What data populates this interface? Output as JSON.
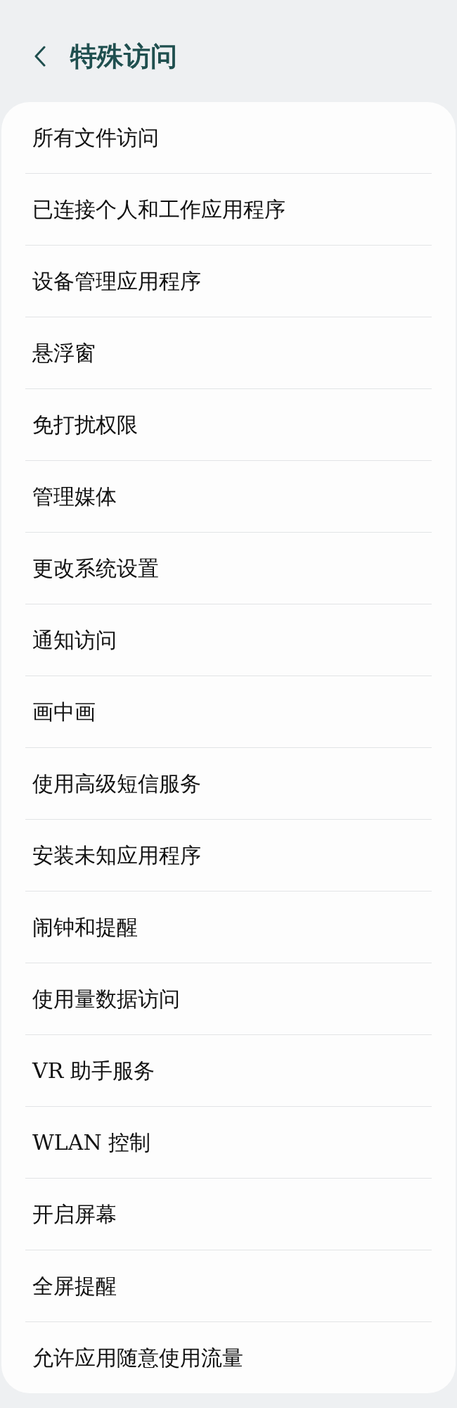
{
  "header": {
    "title": "特殊访问"
  },
  "items": [
    {
      "label": "所有文件访问"
    },
    {
      "label": "已连接个人和工作应用程序"
    },
    {
      "label": "设备管理应用程序"
    },
    {
      "label": "悬浮窗"
    },
    {
      "label": "免打扰权限"
    },
    {
      "label": "管理媒体"
    },
    {
      "label": "更改系统设置"
    },
    {
      "label": "通知访问"
    },
    {
      "label": "画中画"
    },
    {
      "label": "使用高级短信服务"
    },
    {
      "label": "安装未知应用程序"
    },
    {
      "label": "闹钟和提醒"
    },
    {
      "label": "使用量数据访问"
    },
    {
      "label": "VR 助手服务"
    },
    {
      "label": "WLAN 控制"
    },
    {
      "label": "开启屏幕"
    },
    {
      "label": "全屏提醒"
    },
    {
      "label": "允许应用随意使用流量"
    }
  ]
}
